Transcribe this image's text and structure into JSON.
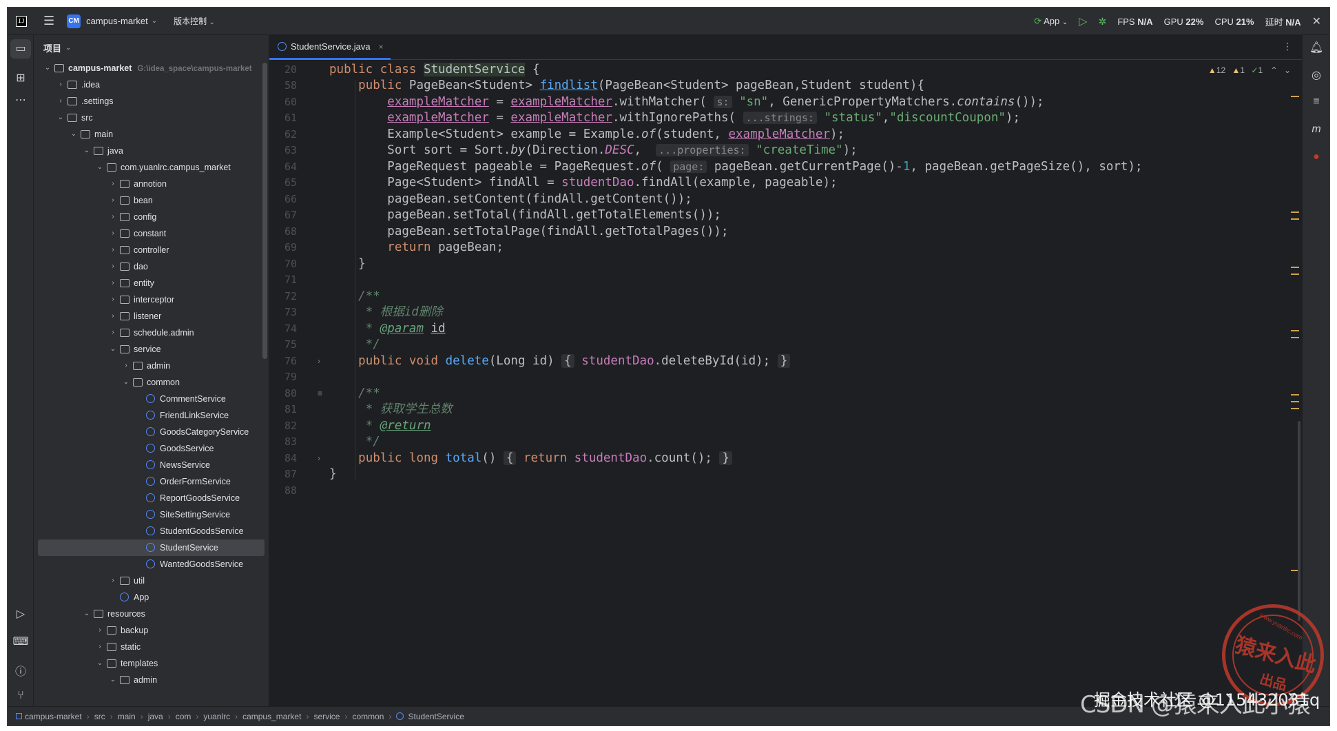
{
  "titlebar": {
    "badge": "CM",
    "project": "campus-market",
    "vcs": "版本控制",
    "run_config": "App",
    "fps_label": "FPS",
    "fps_value": "N/A",
    "gpu_label": "GPU",
    "gpu_value": "22%",
    "cpu_label": "CPU",
    "cpu_value": "21%",
    "time_label": "延时",
    "time_value": "N/A"
  },
  "project_panel": {
    "title": "项目",
    "root_name": "campus-market",
    "root_path": "G:\\idea_space\\campus-market",
    "tree": [
      {
        "label": "campus-market",
        "depth": 0,
        "kind": "module",
        "open": true
      },
      {
        "label": ".idea",
        "depth": 1,
        "kind": "folder",
        "open": false
      },
      {
        "label": ".settings",
        "depth": 1,
        "kind": "folder",
        "open": false
      },
      {
        "label": "src",
        "depth": 1,
        "kind": "folder",
        "open": true
      },
      {
        "label": "main",
        "depth": 2,
        "kind": "folder",
        "open": true
      },
      {
        "label": "java",
        "depth": 3,
        "kind": "folder",
        "open": true
      },
      {
        "label": "com.yuanlrc.campus_market",
        "depth": 4,
        "kind": "package",
        "open": true
      },
      {
        "label": "annotion",
        "depth": 5,
        "kind": "package",
        "open": false
      },
      {
        "label": "bean",
        "depth": 5,
        "kind": "package",
        "open": false
      },
      {
        "label": "config",
        "depth": 5,
        "kind": "package",
        "open": false
      },
      {
        "label": "constant",
        "depth": 5,
        "kind": "package",
        "open": false
      },
      {
        "label": "controller",
        "depth": 5,
        "kind": "package",
        "open": false
      },
      {
        "label": "dao",
        "depth": 5,
        "kind": "package",
        "open": false
      },
      {
        "label": "entity",
        "depth": 5,
        "kind": "package",
        "open": false
      },
      {
        "label": "interceptor",
        "depth": 5,
        "kind": "package",
        "open": false
      },
      {
        "label": "listener",
        "depth": 5,
        "kind": "package",
        "open": false
      },
      {
        "label": "schedule.admin",
        "depth": 5,
        "kind": "package",
        "open": false
      },
      {
        "label": "service",
        "depth": 5,
        "kind": "package",
        "open": true
      },
      {
        "label": "admin",
        "depth": 6,
        "kind": "package",
        "open": false
      },
      {
        "label": "common",
        "depth": 6,
        "kind": "package",
        "open": true
      },
      {
        "label": "CommentService",
        "depth": 7,
        "kind": "class"
      },
      {
        "label": "FriendLinkService",
        "depth": 7,
        "kind": "class"
      },
      {
        "label": "GoodsCategoryService",
        "depth": 7,
        "kind": "class"
      },
      {
        "label": "GoodsService",
        "depth": 7,
        "kind": "class"
      },
      {
        "label": "NewsService",
        "depth": 7,
        "kind": "class"
      },
      {
        "label": "OrderFormService",
        "depth": 7,
        "kind": "class"
      },
      {
        "label": "ReportGoodsService",
        "depth": 7,
        "kind": "class"
      },
      {
        "label": "SiteSettingService",
        "depth": 7,
        "kind": "class"
      },
      {
        "label": "StudentGoodsService",
        "depth": 7,
        "kind": "class"
      },
      {
        "label": "StudentService",
        "depth": 7,
        "kind": "class",
        "selected": true
      },
      {
        "label": "WantedGoodsService",
        "depth": 7,
        "kind": "class"
      },
      {
        "label": "util",
        "depth": 5,
        "kind": "package",
        "open": false
      },
      {
        "label": "App",
        "depth": 5,
        "kind": "app"
      },
      {
        "label": "resources",
        "depth": 3,
        "kind": "folder",
        "open": true
      },
      {
        "label": "backup",
        "depth": 4,
        "kind": "folder",
        "open": false
      },
      {
        "label": "static",
        "depth": 4,
        "kind": "folder",
        "open": false
      },
      {
        "label": "templates",
        "depth": 4,
        "kind": "folder",
        "open": true
      },
      {
        "label": "admin",
        "depth": 5,
        "kind": "folder",
        "open": true
      }
    ]
  },
  "editor": {
    "tab_label": "StudentService.java",
    "tab_close": "×",
    "inspections": {
      "warnings": "12",
      "weak": "1",
      "ok": "1"
    },
    "line_numbers": [
      "20",
      "58",
      "60",
      "61",
      "62",
      "63",
      "64",
      "65",
      "66",
      "67",
      "68",
      "69",
      "70",
      "71",
      "72",
      "73",
      "74",
      "75",
      "76",
      "79",
      "80",
      "81",
      "82",
      "83",
      "84",
      "87",
      "88"
    ],
    "hints": {
      "s": "s:",
      "strings": "...strings:",
      "properties": "...properties:",
      "page": "page:"
    },
    "doc_delete": "根据id删除",
    "doc_total": "获取学生总数"
  },
  "statusbar": {
    "breadcrumbs": [
      "campus-market",
      "src",
      "main",
      "java",
      "com",
      "yuanlrc",
      "campus_market",
      "service",
      "common",
      "StudentService"
    ]
  },
  "watermark": {
    "seal_main": "猿来入此",
    "seal_sub": "出品",
    "seal_url": "www.yuanlrc.com",
    "caption": "CSDN @猿来入此小猿",
    "caption2": "掘金技术社区 @115432031q"
  },
  "colors": {
    "keyword": "#cf8e6d",
    "function": "#56a8f5",
    "field": "#c77dbb",
    "string": "#6aab73",
    "number": "#2aacb8",
    "accent": "#3574f0"
  }
}
